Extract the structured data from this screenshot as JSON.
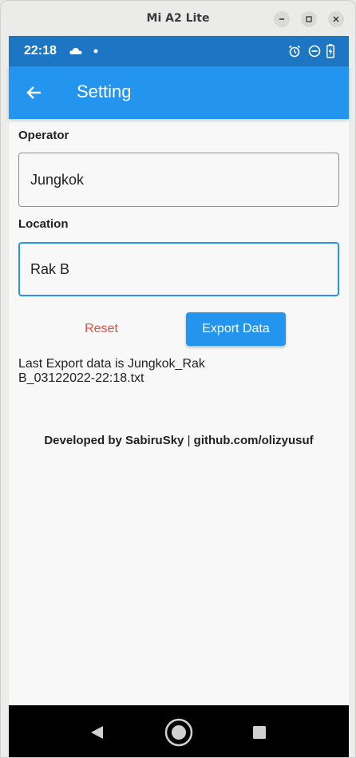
{
  "window": {
    "title": "Mi A2 Lite"
  },
  "status_bar": {
    "time": "22:18",
    "left_icons": [
      "cloud-icon",
      "dot-icon"
    ],
    "right_icons": [
      "alarm-icon",
      "do-not-disturb-icon",
      "battery-charging-icon"
    ]
  },
  "app_bar": {
    "title": "Setting"
  },
  "form": {
    "operator": {
      "label": "Operator",
      "value": "Jungkok"
    },
    "location": {
      "label": "Location",
      "value": "Rak B"
    }
  },
  "actions": {
    "reset_label": "Reset",
    "export_label": "Export Data"
  },
  "last_export": "Last Export data is Jungkok_Rak B_03122022-22:18.txt",
  "footer": {
    "credit": "Developed by SabiruSky",
    "separator": "|",
    "link": "github.com/olizyusuf"
  },
  "colors": {
    "primary": "#2395ef",
    "status_bar": "#1d76c4",
    "reset": "#e34b3f"
  }
}
